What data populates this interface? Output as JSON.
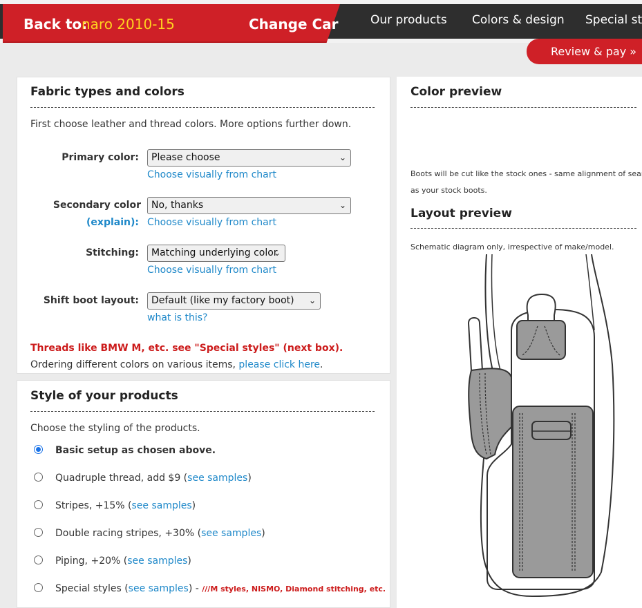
{
  "header": {
    "back_label": "Back to:",
    "car": "naro 2010-15",
    "change_car": "Change Car",
    "nav": [
      "Our products",
      "Colors & design",
      "Special styl"
    ],
    "review_pay": "Review & pay »"
  },
  "fabric": {
    "title": "Fabric types and colors",
    "intro": "First choose leather and thread colors. More options further down.",
    "primary_label": "Primary color:",
    "primary_value": "Please choose",
    "secondary_label": "Secondary color",
    "explain": "(explain):",
    "secondary_value": "No, thanks",
    "stitching_label": "Stitching:",
    "stitching_value": "Matching underlying color",
    "layout_label": "Shift boot layout:",
    "layout_value": "Default (like my factory boot)",
    "chart_link": "Choose visually from chart",
    "what_link": "what is this?",
    "threads_note": "Threads like BMW M, etc. see \"Special styles\" (next box).",
    "ordering_prefix": "Ordering different colors on various items, ",
    "ordering_link": "please click here",
    "ordering_suffix": "."
  },
  "style": {
    "title": "Style of your products",
    "intro": "Choose the styling of the products.",
    "see_samples": "see samples",
    "options": [
      {
        "label": "Basic setup as chosen above.",
        "checked": true
      },
      {
        "label": "Quadruple thread, add $9 (",
        "checked": false
      },
      {
        "label": "Stripes, +15% (",
        "checked": false
      },
      {
        "label": "Double racing stripes, +30% (",
        "checked": false
      },
      {
        "label": "Piping, +20% (",
        "checked": false
      },
      {
        "label": "Special styles (",
        "checked": false
      }
    ],
    "close_paren": ")",
    "special_dash": " - ",
    "special_note": "///M styles, NISMO, Diamond stitching, etc."
  },
  "preview": {
    "color_title": "Color preview",
    "boots_note_1": "Boots will be cut like the stock ones - same alignment of seams",
    "boots_note_2": "as your stock boots.",
    "layout_title": "Layout preview",
    "schematic_note": "Schematic diagram only, irrespective of make/model."
  }
}
